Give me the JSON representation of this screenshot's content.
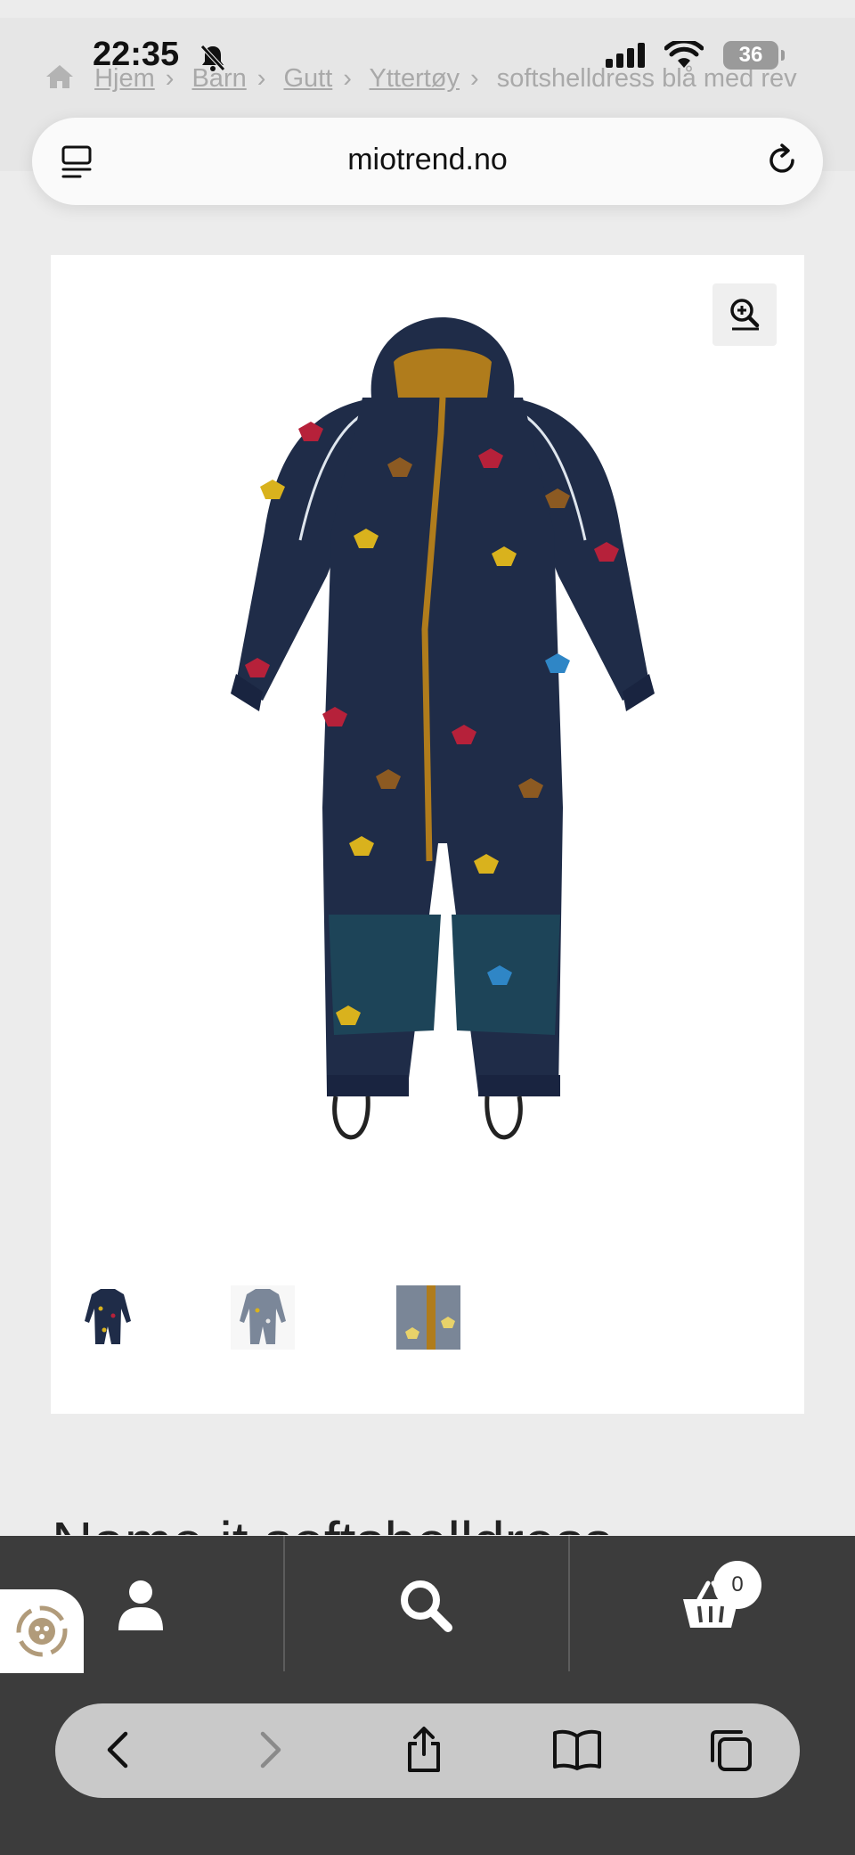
{
  "status": {
    "time": "22:35",
    "battery": "36"
  },
  "browser": {
    "url": "miotrend.no"
  },
  "breadcrumb": {
    "items": [
      "Hjem",
      "Barn",
      "Gutt",
      "Yttertøy"
    ],
    "current": "softshelldress blå med rev"
  },
  "product": {
    "title": "Name it softshelldress"
  },
  "cart": {
    "count": "0"
  },
  "colors": {
    "nav_bg": "#3c3c3c",
    "suit_navy": "#1f2c48",
    "zipper": "#b07c1c",
    "knee_patch": "#1d4458"
  },
  "icons": {
    "tabs": "tab-list-icon",
    "reload": "reload-icon",
    "zoom": "zoom-in-icon",
    "user": "user-icon",
    "search": "search-icon",
    "cart": "basket-icon",
    "back": "chevron-left-icon",
    "forward": "chevron-right-icon",
    "share": "share-icon",
    "bookmarks": "book-icon",
    "tabs_overview": "tabs-icon"
  }
}
